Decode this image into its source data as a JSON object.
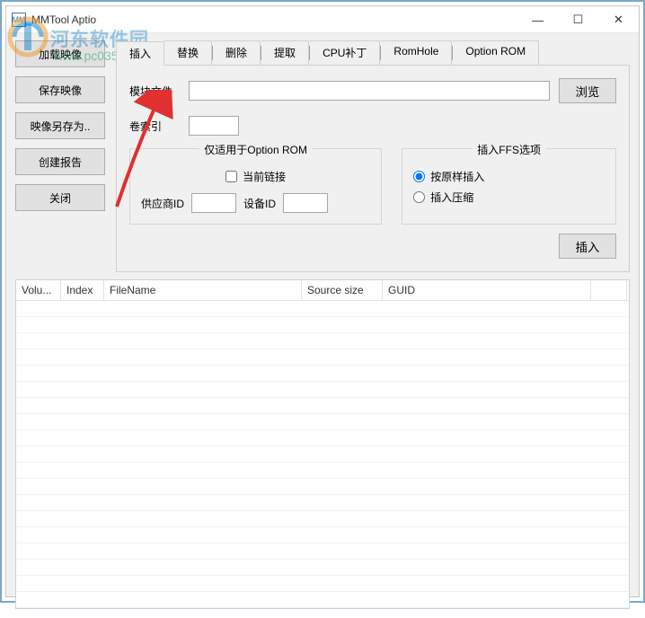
{
  "window": {
    "title": "MMTool Aptio",
    "icon_text": "MM"
  },
  "watermark": {
    "site_name": "河东软件园",
    "url": "www.pc0359.cn"
  },
  "side_buttons": {
    "load": "加载映像",
    "save": "保存映像",
    "save_as": "映像另存为..",
    "report": "创建报告",
    "close": "关闭"
  },
  "tabs": {
    "insert": "插入",
    "replace": "替换",
    "delete": "删除",
    "extract": "提取",
    "cpu_patch": "CPU补丁",
    "romhole": "RomHole",
    "option_rom": "Option ROM"
  },
  "panel": {
    "module_file_label": "模块文件",
    "browse": "浏览",
    "volume_index_label": "卷索引",
    "optrom_legend": "仅适用于Option ROM",
    "current_link": "当前链接",
    "vendor_id": "供应商ID",
    "device_id": "设备ID",
    "ffs_legend": "插入FFS选项",
    "insert_asis": "按原样插入",
    "insert_compressed": "插入压缩",
    "insert_btn": "插入"
  },
  "table": {
    "cols": {
      "volume": "Volu...",
      "index": "Index",
      "filename": "FileName",
      "source_size": "Source size",
      "guid": "GUID"
    },
    "widths": {
      "volume": 50,
      "index": 48,
      "filename": 220,
      "source_size": 90,
      "guid": 232,
      "tail": 40
    }
  }
}
